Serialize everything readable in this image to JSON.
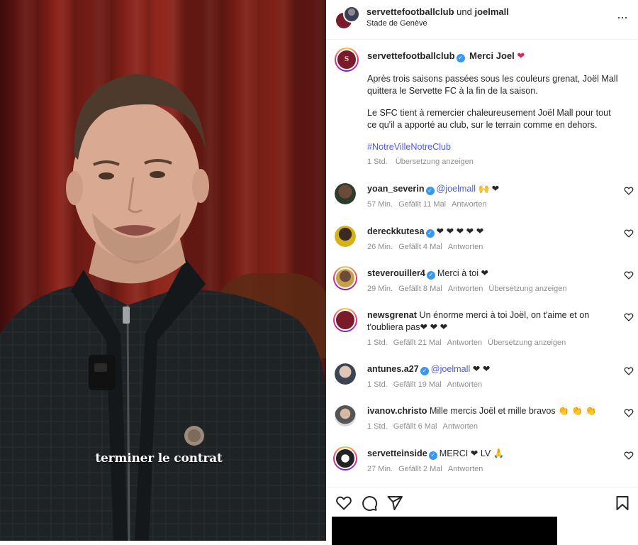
{
  "video": {
    "caption": "terminer le contrat"
  },
  "header": {
    "user1": "servettefootballclub",
    "joiner": " und ",
    "user2": "joelmall",
    "location": "Stade de Genève",
    "more_label": "..."
  },
  "post": {
    "author": "servettefootballclub",
    "title": "Merci Joel",
    "paragraph1": "Après trois saisons passées sous les couleurs grenat, Joël Mall quittera le Servette FC à la fin de la saison.",
    "paragraph2": "Le SFC tient à remercier chaleureusement Joël Mall pour tout ce qu'il a apporté au club, sur le terrain comme en dehors.",
    "hashtag": "#NotreVilleNotreClub",
    "time": "1 Std.",
    "translate": "Übersetzung anzeigen"
  },
  "comments": [
    {
      "username": "yoan_severin",
      "verified": true,
      "text_prefix": "",
      "mention": "@joelmall",
      "text": " 🙌 ❤",
      "time": "57 Min.",
      "likes": "Gefällt 11 Mal",
      "reply": "Antworten",
      "translate": ""
    },
    {
      "username": "dereckkutesa",
      "verified": true,
      "text_prefix": "",
      "mention": "",
      "text": "❤ ❤ ❤ ❤ ❤",
      "time": "26 Min.",
      "likes": "Gefällt 4 Mal",
      "reply": "Antworten",
      "translate": ""
    },
    {
      "username": "steverouiller4",
      "verified": true,
      "text_prefix": "",
      "mention": "",
      "text": "Merci à toi ❤",
      "time": "29 Min.",
      "likes": "Gefällt 8 Mal",
      "reply": "Antworten",
      "translate": "Übersetzung anzeigen"
    },
    {
      "username": "newsgrenat",
      "verified": false,
      "text_prefix": "",
      "mention": "",
      "text": "Un énorme merci à toi Joël, on t'aime et on t'oubliera pas❤ ❤ ❤",
      "time": "1 Std.",
      "likes": "Gefällt 21 Mal",
      "reply": "Antworten",
      "translate": "Übersetzung anzeigen"
    },
    {
      "username": "antunes.a27",
      "verified": true,
      "text_prefix": "",
      "mention": "@joelmall",
      "text": " ❤ ❤",
      "time": "1 Std.",
      "likes": "Gefällt 19 Mal",
      "reply": "Antworten",
      "translate": ""
    },
    {
      "username": "ivanov.christo",
      "verified": false,
      "text_prefix": "",
      "mention": "",
      "text": "Mille mercis Joël et mille bravos 👏 👏 👏",
      "time": "1 Std.",
      "likes": "Gefällt 6 Mal",
      "reply": "Antworten",
      "translate": ""
    },
    {
      "username": "servetteinside",
      "verified": true,
      "text_prefix": "",
      "mention": "",
      "text": "MERCI ❤ LV 🙏",
      "time": "27 Min.",
      "likes": "Gefällt 2 Mal",
      "reply": "Antworten",
      "translate": ""
    }
  ],
  "icons": {
    "like": "heart-icon",
    "comment": "comment-icon",
    "share": "share-icon",
    "save": "bookmark-icon",
    "verified": "verified-icon",
    "more": "more-icon"
  },
  "colors": {
    "brand_grenat": "#7a1b2b",
    "link": "#4f5bd5",
    "verified": "#3897f0",
    "heart": "#e0245e",
    "meta_gray": "#8e8e8e"
  }
}
